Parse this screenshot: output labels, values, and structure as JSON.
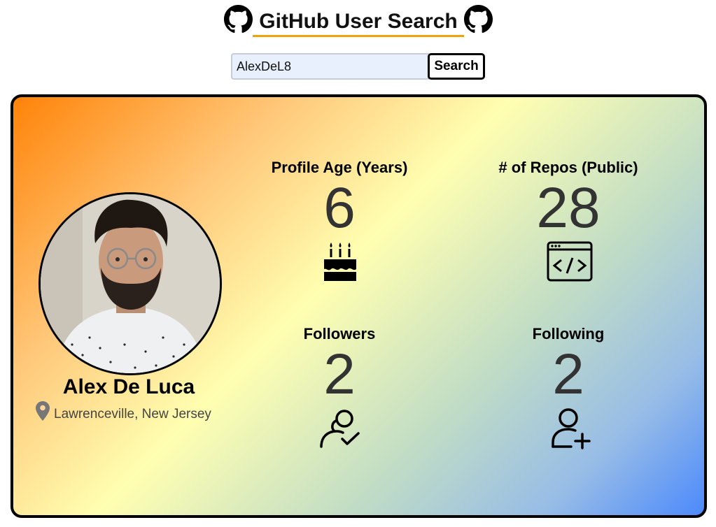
{
  "header": {
    "title": "GitHub User Search",
    "icon_left": "github-icon",
    "icon_right": "github-icon",
    "underline_color": "#f0a30a"
  },
  "search": {
    "value": "AlexDeL8",
    "button_label": "Search"
  },
  "profile": {
    "name": "Alex De Luca",
    "location": "Lawrenceville, New Jersey",
    "location_icon": "map-pin-icon",
    "avatar_icon": "profile-photo"
  },
  "stats": [
    {
      "label": "Profile Age (Years)",
      "value": "6",
      "icon": "birthday-cake-icon"
    },
    {
      "label": "# of Repos (Public)",
      "value": "28",
      "icon": "code-window-icon"
    },
    {
      "label": "Followers",
      "value": "2",
      "icon": "users-check-icon"
    },
    {
      "label": "Following",
      "value": "2",
      "icon": "user-plus-icon"
    }
  ],
  "colors": {
    "gradient_start": "#ff8308",
    "gradient_mid": "#ffffb1",
    "gradient_end": "#4c8afc",
    "stat_value": "#333333"
  }
}
